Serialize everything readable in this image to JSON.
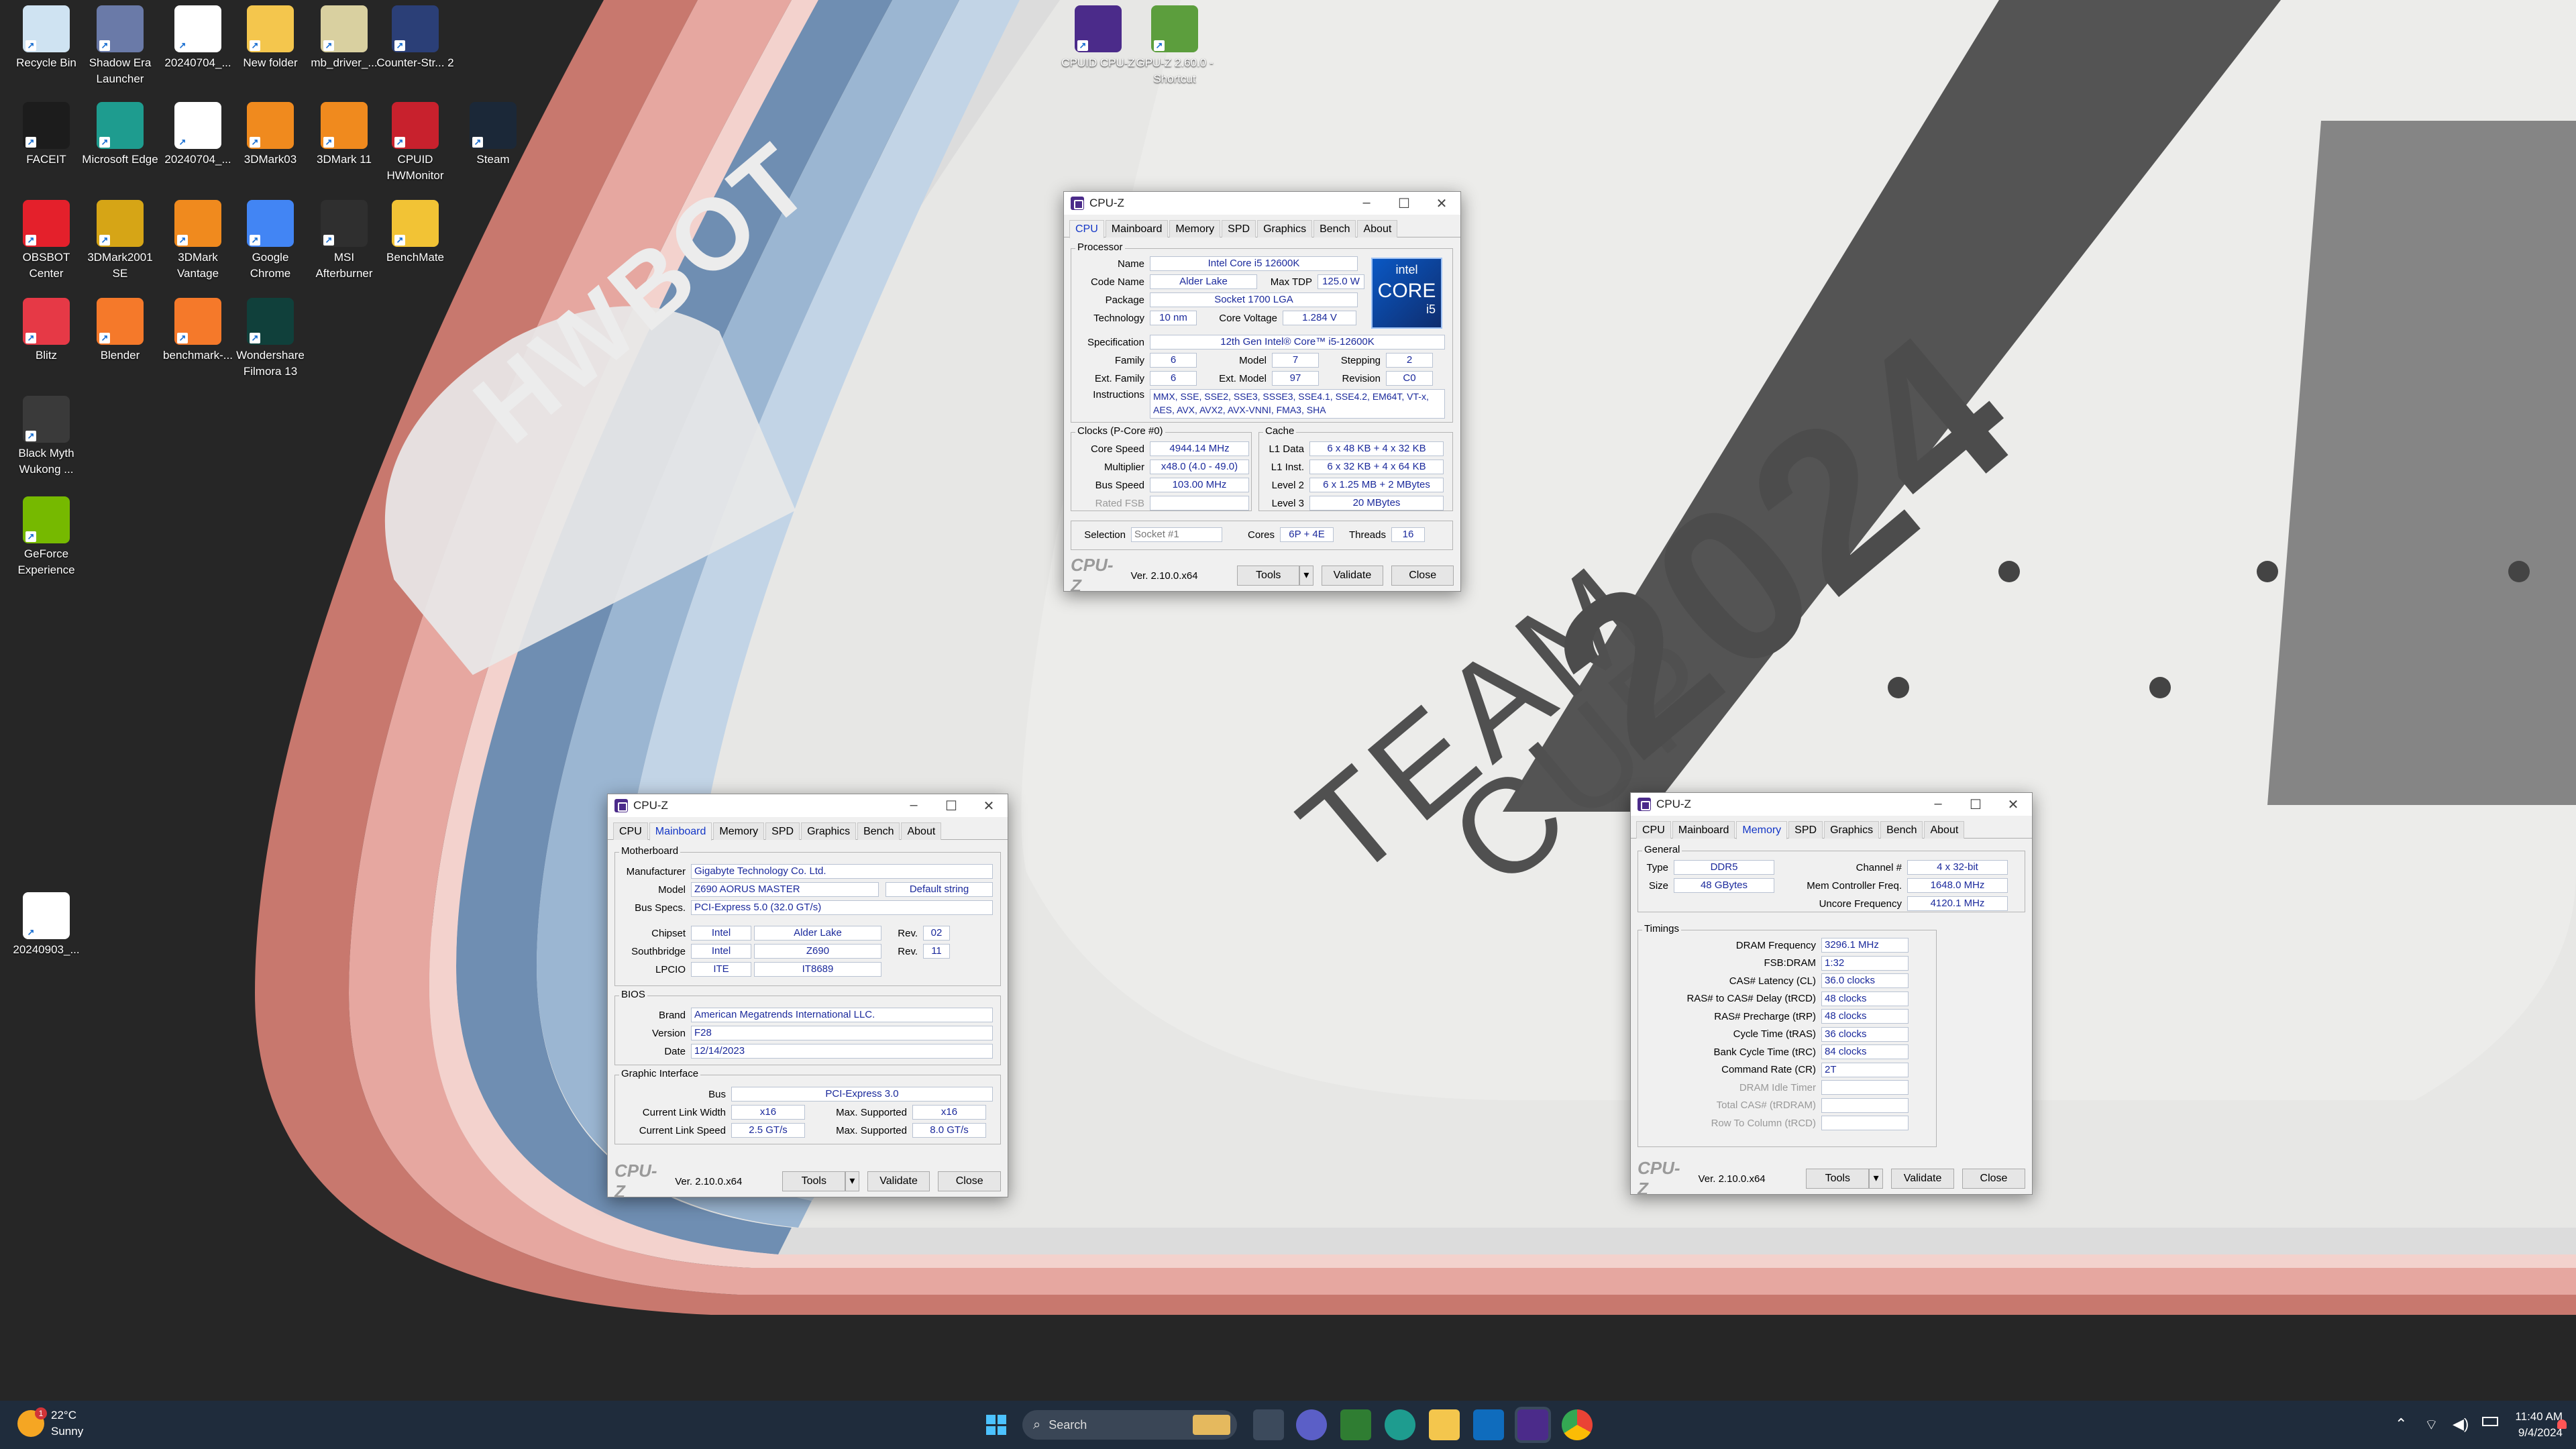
{
  "desktop": {
    "icons": [
      {
        "label": "Recycle Bin",
        "icon": "recycle-bin-icon",
        "color": "#cfe3f2"
      },
      {
        "label": "Shadow Era Launcher",
        "icon": "game-icon",
        "color": "#6a7aa8"
      },
      {
        "label": "20240704_...",
        "icon": "image-file-icon",
        "color": "#ffffff"
      },
      {
        "label": "New folder",
        "icon": "folder-icon",
        "color": "#f4c64d"
      },
      {
        "label": "mb_driver_...",
        "icon": "installer-icon",
        "color": "#d9d0a0"
      },
      {
        "label": "Counter-Str... 2",
        "icon": "cs2-icon",
        "color": "#2b3f77"
      },
      {
        "label": "FACEIT",
        "icon": "faceit-icon",
        "color": "#1c1c1c"
      },
      {
        "label": "Microsoft Edge",
        "icon": "edge-icon",
        "color": "#1e9c8f"
      },
      {
        "label": "20240704_...",
        "icon": "image-file-icon",
        "color": "#ffffff"
      },
      {
        "label": "3DMark03",
        "icon": "3dmark-icon",
        "color": "#f08a1e"
      },
      {
        "label": "3DMark 11",
        "icon": "3dmark-icon",
        "color": "#f08a1e"
      },
      {
        "label": "CPUID HWMonitor",
        "icon": "hwmonitor-icon",
        "color": "#c8212d"
      },
      {
        "label": "Steam",
        "icon": "steam-icon",
        "color": "#1b2838"
      },
      {
        "label": "OBSBOT Center",
        "icon": "obsbot-icon",
        "color": "#e4202b"
      },
      {
        "label": "3DMark2001 SE",
        "icon": "3dmark-icon",
        "color": "#d6a516"
      },
      {
        "label": "3DMark Vantage",
        "icon": "3dmark-icon",
        "color": "#f08a1e"
      },
      {
        "label": "Google Chrome",
        "icon": "chrome-icon",
        "color": "#4285f4"
      },
      {
        "label": "MSI Afterburner",
        "icon": "afterburner-icon",
        "color": "#2f2f2f"
      },
      {
        "label": "BenchMate",
        "icon": "benchmate-icon",
        "color": "#f2c335"
      },
      {
        "label": "Blitz",
        "icon": "blitz-icon",
        "color": "#e63946"
      },
      {
        "label": "Blender",
        "icon": "blender-icon",
        "color": "#f5792a"
      },
      {
        "label": "benchmark-...",
        "icon": "blender-icon",
        "color": "#f5792a"
      },
      {
        "label": "Wondershare Filmora 13",
        "icon": "filmora-icon",
        "color": "#10403b"
      },
      {
        "label": "Black Myth Wukong ...",
        "icon": "game-icon",
        "color": "#3a3a3a"
      },
      {
        "label": "GeForce Experience",
        "icon": "geforce-icon",
        "color": "#76b900"
      },
      {
        "label": "20240903_...",
        "icon": "image-file-icon",
        "color": "#ffffff"
      },
      {
        "label": "CPUID CPU-Z",
        "icon": "cpuz-icon",
        "color": "#4b2b8a"
      },
      {
        "label": "GPU-Z 2.60.0 - Shortcut",
        "icon": "gpuz-icon",
        "color": "#5c9e3d"
      }
    ]
  },
  "wallpaper": {
    "logo": "HWBOT",
    "line1": "TEAM",
    "line2": "CUP",
    "year": "2024"
  },
  "win_cpu": {
    "title": "CPU-Z",
    "tabs": [
      "CPU",
      "Mainboard",
      "Memory",
      "SPD",
      "Graphics",
      "Bench",
      "About"
    ],
    "processor_label": "Processor",
    "name_l": "Name",
    "name": "Intel Core i5 12600K",
    "codename_l": "Code Name",
    "codename": "Alder Lake",
    "tdp_l": "Max TDP",
    "tdp": "125.0 W",
    "package_l": "Package",
    "package": "Socket 1700 LGA",
    "tech_l": "Technology",
    "tech": "10 nm",
    "vcore_l": "Core Voltage",
    "vcore": "1.284 V",
    "spec_l": "Specification",
    "spec": "12th Gen Intel® Core™ i5-12600K",
    "family_l": "Family",
    "family": "6",
    "model_l": "Model",
    "model": "7",
    "stepping_l": "Stepping",
    "stepping": "2",
    "extfam_l": "Ext. Family",
    "extfam": "6",
    "extmodel_l": "Ext. Model",
    "extmodel": "97",
    "revision_l": "Revision",
    "revision": "C0",
    "instr_l": "Instructions",
    "instr": "MMX, SSE, SSE2, SSE3, SSSE3, SSE4.1, SSE4.2, EM64T, VT-x, AES, AVX, AVX2, AVX-VNNI, FMA3, SHA",
    "badge_brand": "intel",
    "badge_core": "CORE",
    "badge_tier": "i5",
    "clocks_label": "Clocks (P-Core #0)",
    "corespeed_l": "Core Speed",
    "corespeed": "4944.14 MHz",
    "mult_l": "Multiplier",
    "mult": "x48.0 (4.0 - 49.0)",
    "bus_l": "Bus Speed",
    "bus": "103.00 MHz",
    "fsb_l": "Rated FSB",
    "fsb": "",
    "cache_label": "Cache",
    "l1d_l": "L1 Data",
    "l1d": "6 x 48 KB + 4 x 32 KB",
    "l1i_l": "L1 Inst.",
    "l1i": "6 x 32 KB + 4 x 64 KB",
    "l2_l": "Level 2",
    "l2": "6 x 1.25 MB + 2 MBytes",
    "l3_l": "Level 3",
    "l3": "20 MBytes",
    "sel_l": "Selection",
    "sel": "Socket #1",
    "cores_l": "Cores",
    "cores": "6P + 4E",
    "threads_l": "Threads",
    "threads": "16",
    "brand": "CPU-Z",
    "version": "Ver. 2.10.0.x64",
    "tools": "Tools",
    "validate": "Validate",
    "close": "Close"
  },
  "win_mb": {
    "title": "CPU-Z",
    "tabs": [
      "CPU",
      "Mainboard",
      "Memory",
      "SPD",
      "Graphics",
      "Bench",
      "About"
    ],
    "mb_label": "Motherboard",
    "manu_l": "Manufacturer",
    "manu": "Gigabyte Technology Co. Ltd.",
    "model_l": "Model",
    "model": "Z690 AORUS MASTER",
    "model2": "Default string",
    "busspec_l": "Bus Specs.",
    "busspec": "PCI-Express 5.0 (32.0 GT/s)",
    "chipset_l": "Chipset",
    "chipset_v": "Intel",
    "chipset_n": "Alder Lake",
    "chipset_rev_l": "Rev.",
    "chipset_rev": "02",
    "south_l": "Southbridge",
    "south_v": "Intel",
    "south_n": "Z690",
    "south_rev_l": "Rev.",
    "south_rev": "11",
    "lpcio_l": "LPCIO",
    "lpcio_v": "ITE",
    "lpcio_n": "IT8689",
    "bios_label": "BIOS",
    "brand_l": "Brand",
    "bios_brand": "American Megatrends International LLC.",
    "ver_l": "Version",
    "bios_ver": "F28",
    "date_l": "Date",
    "bios_date": "12/14/2023",
    "gi_label": "Graphic Interface",
    "bus_l": "Bus",
    "bus": "PCI-Express 3.0",
    "clw_l": "Current Link Width",
    "clw": "x16",
    "mls_l": "Max. Supported",
    "mlw": "x16",
    "cls_l": "Current Link Speed",
    "cls": "2.5 GT/s",
    "mls2_l": "Max. Supported",
    "mls": "8.0 GT/s",
    "brand": "CPU-Z",
    "version": "Ver. 2.10.0.x64",
    "tools": "Tools",
    "validate": "Validate",
    "close": "Close"
  },
  "win_mem": {
    "title": "CPU-Z",
    "tabs": [
      "CPU",
      "Mainboard",
      "Memory",
      "SPD",
      "Graphics",
      "Bench",
      "About"
    ],
    "gen_label": "General",
    "type_l": "Type",
    "type": "DDR5",
    "chan_l": "Channel #",
    "chan": "4 x 32-bit",
    "size_l": "Size",
    "size": "48 GBytes",
    "mcf_l": "Mem Controller Freq.",
    "mcf": "1648.0 MHz",
    "unc_l": "Uncore Frequency",
    "unc": "4120.1 MHz",
    "tim_label": "Timings",
    "t": [
      {
        "l": "DRAM Frequency",
        "v": "3296.1 MHz"
      },
      {
        "l": "FSB:DRAM",
        "v": "1:32"
      },
      {
        "l": "CAS# Latency (CL)",
        "v": "36.0 clocks"
      },
      {
        "l": "RAS# to CAS# Delay (tRCD)",
        "v": "48 clocks"
      },
      {
        "l": "RAS# Precharge (tRP)",
        "v": "48 clocks"
      },
      {
        "l": "Cycle Time (tRAS)",
        "v": "36 clocks"
      },
      {
        "l": "Bank Cycle Time (tRC)",
        "v": "84 clocks"
      },
      {
        "l": "Command Rate (CR)",
        "v": "2T"
      },
      {
        "l": "DRAM Idle Timer",
        "v": ""
      },
      {
        "l": "Total CAS# (tRDRAM)",
        "v": ""
      },
      {
        "l": "Row To Column (tRCD)",
        "v": ""
      }
    ],
    "brand": "CPU-Z",
    "version": "Ver. 2.10.0.x64",
    "tools": "Tools",
    "validate": "Validate",
    "close": "Close"
  },
  "taskbar": {
    "temp": "22°C",
    "weather": "Sunny",
    "badge": "1",
    "search": "Search",
    "time": "11:40 AM",
    "date": "9/4/2024"
  }
}
